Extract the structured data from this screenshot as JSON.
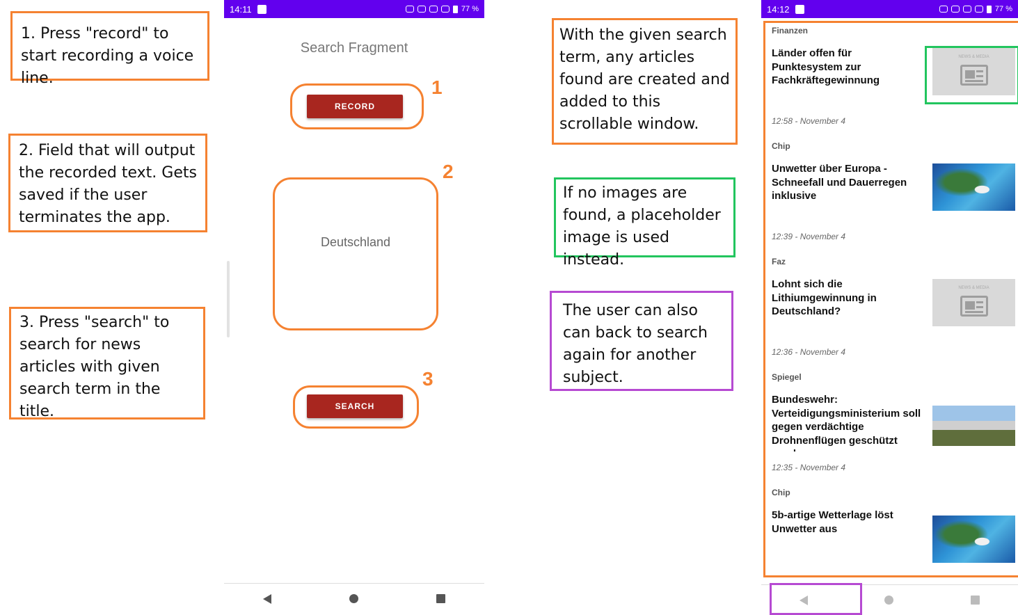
{
  "notes": {
    "record": "1. Press \"record\" to start recording a voice line.",
    "field": "2. Field that will output the recorded text. Gets saved if the user terminates the app.",
    "search": "3. Press \"search\" to search for news articles with given search term in the title.",
    "articles": "With the given search term, any articles found are created and added to this scrollable window.",
    "placeholder": "If no images are found, a placeholder image is used instead.",
    "back": "The user can also can back to search again for another subject."
  },
  "numbers": {
    "n1": "1",
    "n2": "2",
    "n3": "3"
  },
  "phone1": {
    "status": {
      "time": "14:11",
      "battery": "77 %"
    },
    "title": "Search Fragment",
    "record_label": "RECORD",
    "recorded_text": "Deutschland",
    "search_label": "SEARCH"
  },
  "phone2": {
    "status": {
      "time": "14:12",
      "battery": "77 %"
    },
    "top_source": "Finanzen",
    "articles": [
      {
        "title": "Länder offen für Punktesystem zur Fachkräftegewinnung",
        "time": "12:58 - November 4",
        "image": "placeholder-image",
        "next_source": "Chip"
      },
      {
        "title": "Unwetter über Europa - Schneefall und Dauerregen inklusive",
        "time": "12:39 - November 4",
        "image": "weather-map-image",
        "next_source": "Faz"
      },
      {
        "title": "Lohnt sich die Lithiumgewinnung in Deutschland?",
        "time": "12:36 - November 4",
        "image": "placeholder-image",
        "next_source": "Spiegel"
      },
      {
        "title": "Bundeswehr: Verteidigungsministerium soll gegen verdächtige Drohnenflügen geschützt werden",
        "time": "12:35 - November 4",
        "image": "building-photo",
        "next_source": "Chip"
      },
      {
        "title": "5b-artige Wetterlage löst Unwetter aus",
        "time": "",
        "image": "weather-map-image",
        "next_source": ""
      }
    ],
    "placeholder_caption": "NEWS & MEDIA"
  },
  "colors": {
    "accent": "#6200ee",
    "button": "#a8261f",
    "annot_orange": "#f58231",
    "annot_green": "#22c55e",
    "annot_purple": "#b64ad2"
  }
}
